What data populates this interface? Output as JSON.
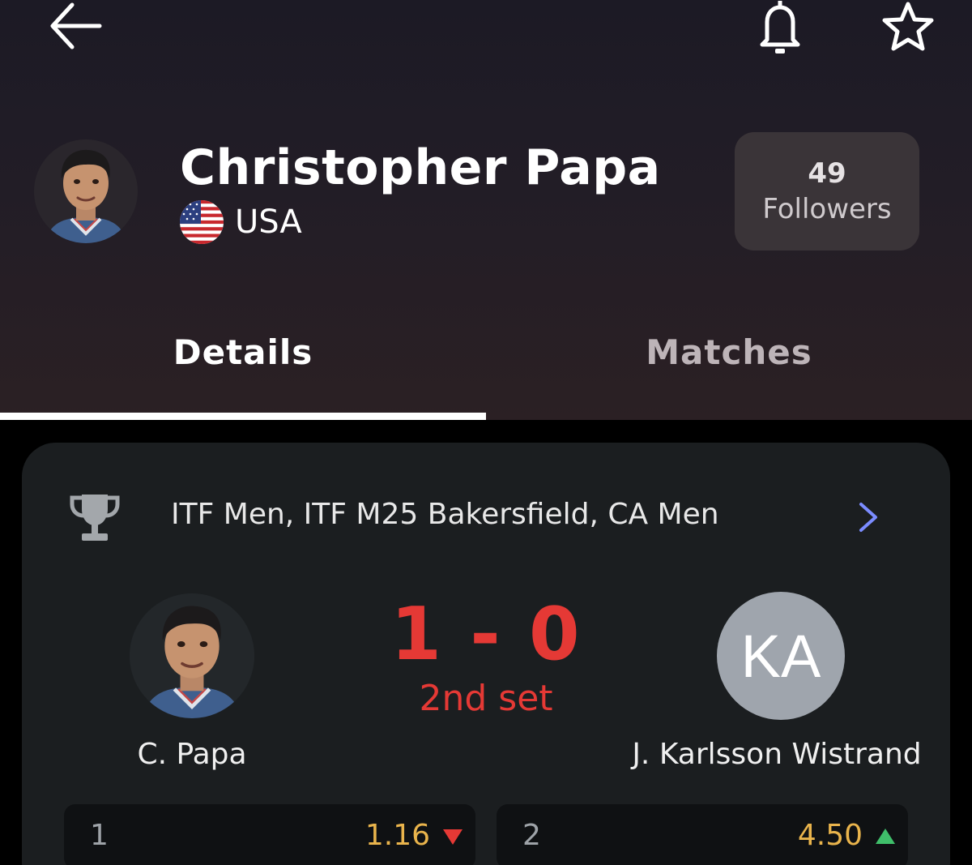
{
  "header": {
    "back_icon": "arrow-left-icon",
    "notify_icon": "bell-icon",
    "favorite_icon": "star-icon",
    "player": {
      "name": "Christopher Papa",
      "country": "USA",
      "flag_icon": "usa-flag-icon"
    },
    "followers": {
      "count": "49",
      "label": "Followers"
    },
    "tabs": [
      {
        "label": "Details",
        "active": true
      },
      {
        "label": "Matches",
        "active": false
      }
    ]
  },
  "match": {
    "tournament": "ITF Men, ITF M25 Bakersfield, CA Men",
    "tournament_icon": "trophy-icon",
    "score": "1 - 0",
    "status": "2nd set",
    "home": {
      "short_name": "C. Papa"
    },
    "away": {
      "short_name": "J. Karlsson Wistrand",
      "initials": "KA"
    },
    "odds": [
      {
        "label": "1",
        "value": "1.16",
        "trend": "down"
      },
      {
        "label": "2",
        "value": "4.50",
        "trend": "up"
      }
    ]
  },
  "colors": {
    "accent_live": "#e53935",
    "odds": "#e9b44c",
    "trend_down": "#e53935",
    "trend_up": "#3fbf6a",
    "chevron": "#7b8cff"
  }
}
